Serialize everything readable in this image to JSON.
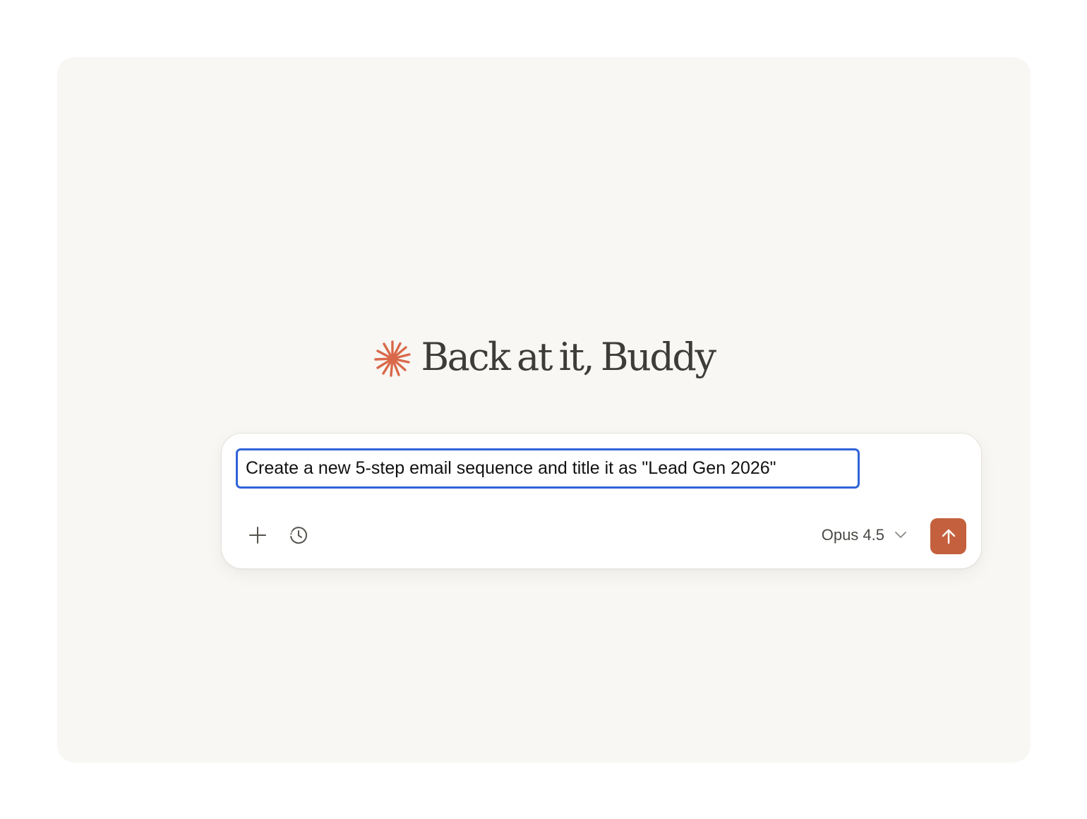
{
  "greeting": {
    "text": "Back at it, Buddy",
    "icon": "spark-icon",
    "icon_color": "#d9694a"
  },
  "composer": {
    "prompt_text": "Create a new 5-step email sequence and title it as \"Lead Gen 2026\"",
    "add_icon": "plus-icon",
    "history_icon": "history-icon",
    "model_label": "Opus 4.5",
    "model_dropdown_icon": "chevron-down-icon",
    "send_icon": "arrow-up-icon",
    "send_color": "#c4603d",
    "focus_color": "#2f63d8"
  }
}
